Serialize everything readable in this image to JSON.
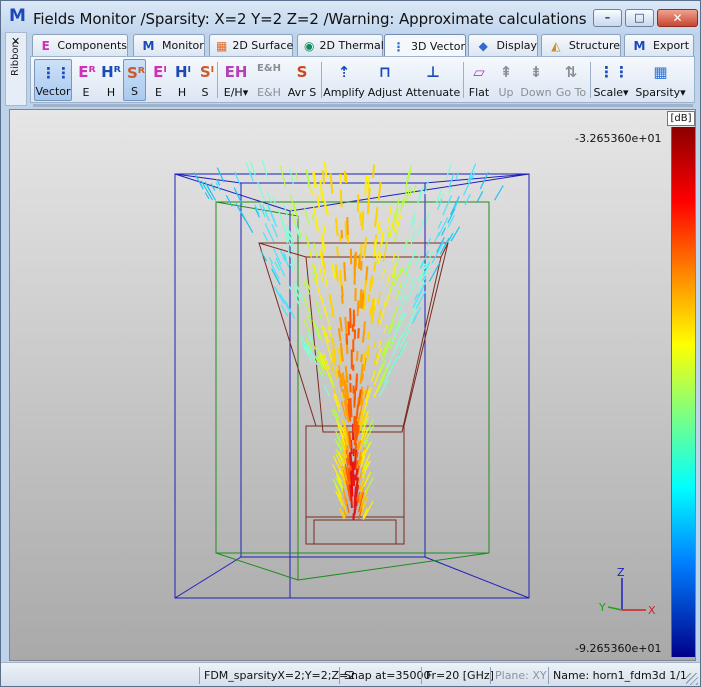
{
  "window": {
    "title": "Fields Monitor /Sparsity: X=2 Y=2 Z=2 /Warning: Approximate calculations",
    "logo_letter": "M",
    "controls": {
      "minimize": "–",
      "maximize": "□",
      "close": "✕"
    }
  },
  "ribbon": {
    "close_glyph": "✕",
    "label": "Ribbon",
    "tabs": [
      {
        "icon": "components-e-icon",
        "label": "Components",
        "glyph": "E",
        "color": "#d02fb8"
      },
      {
        "icon": "monitor-m-icon",
        "label": "Monitor",
        "glyph": "M",
        "color": "#1c49b8"
      },
      {
        "icon": "2d-surface-icon",
        "label": "2D Surface",
        "glyph": "▦",
        "color": "#e06a28"
      },
      {
        "icon": "2d-thermal-icon",
        "label": "2D Thermal",
        "glyph": "◉",
        "color": "#0b8f58"
      },
      {
        "icon": "3d-vector-icon",
        "label": "3D Vector",
        "glyph": "⋮",
        "color": "#1e65c8"
      },
      {
        "icon": "display-icon",
        "label": "Display",
        "glyph": "◆",
        "color": "#2f6ad1"
      },
      {
        "icon": "structure-icon",
        "label": "Structure",
        "glyph": "◭",
        "color": "#c78d25"
      },
      {
        "icon": "export-icon",
        "label": "Export",
        "glyph": "M",
        "color": "#1c49b8"
      }
    ],
    "active_tab": "3D Vector",
    "tools": [
      {
        "id": "vector",
        "label": "Vector",
        "glyph": "⋮⋮",
        "color": "#1c49b8",
        "pressed": true,
        "disabled": false
      },
      {
        "id": "e-real",
        "label": "E",
        "glyph": "Eᴿ",
        "color": "#d02fb8",
        "pressed": false,
        "disabled": false
      },
      {
        "id": "h-real",
        "label": "H",
        "glyph": "Hᴿ",
        "color": "#1c49b8",
        "pressed": false,
        "disabled": false
      },
      {
        "id": "s-real",
        "label": "S",
        "glyph": "Sᴿ",
        "color": "#cc5a2a",
        "pressed": true,
        "disabled": false
      },
      {
        "id": "e-imag",
        "label": "E",
        "glyph": "Eᴵ",
        "color": "#d02fb8",
        "pressed": false,
        "disabled": false
      },
      {
        "id": "h-imag",
        "label": "H",
        "glyph": "Hᴵ",
        "color": "#1c49b8",
        "pressed": false,
        "disabled": false
      },
      {
        "id": "s-imag",
        "label": "S",
        "glyph": "Sᴵ",
        "color": "#cc5a2a",
        "pressed": false,
        "disabled": false
      },
      {
        "id": "e-h-menu",
        "label": "E/H▾",
        "glyph": "EH",
        "color": "#b640b5",
        "pressed": false,
        "disabled": false
      },
      {
        "id": "e-and-h",
        "label": "E&H",
        "glyph": "E&H",
        "color": "#8a8f96",
        "pressed": false,
        "disabled": true
      },
      {
        "id": "avr-s",
        "label": "Avr S",
        "glyph": "S",
        "color": "#c94822",
        "pressed": false,
        "disabled": false
      },
      {
        "id": "amplify",
        "label": "Amplify",
        "glyph": "⇡",
        "color": "#1c49b8",
        "pressed": false,
        "disabled": false
      },
      {
        "id": "adjust",
        "label": "Adjust",
        "glyph": "⊓",
        "color": "#1c49b8",
        "pressed": false,
        "disabled": false
      },
      {
        "id": "attenuate",
        "label": "Attenuate",
        "glyph": "⊥",
        "color": "#1c49b8",
        "pressed": false,
        "disabled": false
      },
      {
        "id": "flat",
        "label": "Flat",
        "glyph": "▱",
        "color": "#b13cb4",
        "pressed": false,
        "disabled": false
      },
      {
        "id": "up",
        "label": "Up",
        "glyph": "⇞",
        "color": "#8a8f96",
        "pressed": false,
        "disabled": true
      },
      {
        "id": "down",
        "label": "Down",
        "glyph": "⇟",
        "color": "#8a8f96",
        "pressed": false,
        "disabled": true
      },
      {
        "id": "go-to",
        "label": "Go To",
        "glyph": "⇅",
        "color": "#8a8f96",
        "pressed": false,
        "disabled": true
      },
      {
        "id": "scale",
        "label": "Scale▾",
        "glyph": "⋮⋮",
        "color": "#1c49b8",
        "pressed": false,
        "disabled": false
      },
      {
        "id": "sparsity",
        "label": "Sparsity▾",
        "glyph": "▦",
        "color": "#2d70d4",
        "pressed": false,
        "disabled": false
      }
    ]
  },
  "viewport": {
    "unit": "[dB]",
    "scale_max": "-3.265360e+01",
    "scale_min": "-9.265360e+01",
    "axes": {
      "x": "X",
      "y": "Y",
      "z": "Z"
    }
  },
  "status": {
    "sparsity": "FDM_sparsityX=2;Y=2;Z=2",
    "snap": "Snap at=35000",
    "frequency": "Fr=20 [GHz]",
    "plane": "Plane: XY",
    "name": "Name: horn1_fdm3d 1/1"
  }
}
